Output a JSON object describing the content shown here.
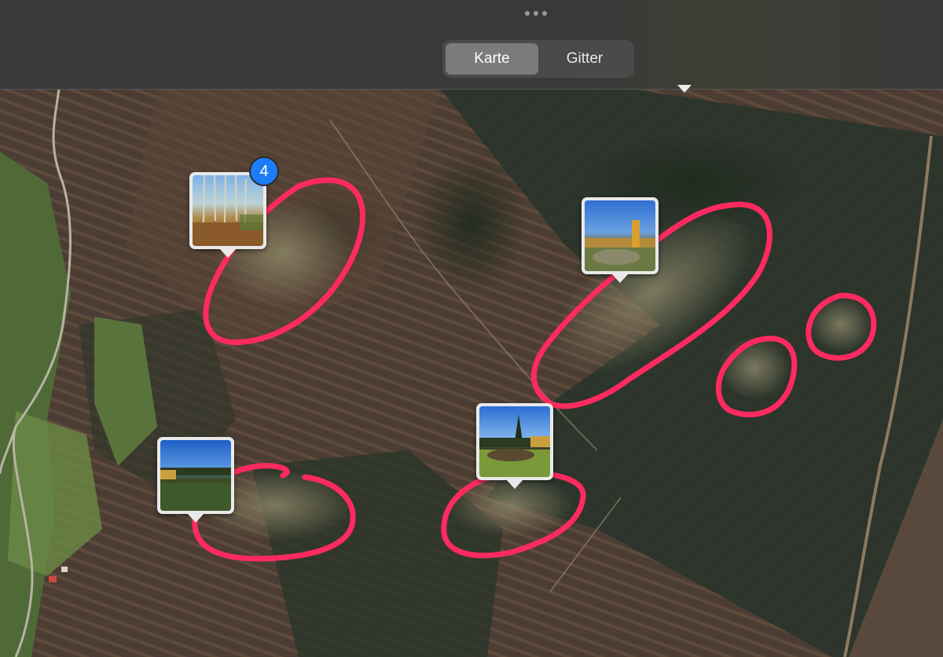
{
  "toolbar": {
    "more_icon": "ellipsis-icon",
    "segments": [
      {
        "label": "Karte",
        "selected": true
      },
      {
        "label": "Gitter",
        "selected": false
      }
    ]
  },
  "map": {
    "type": "satellite",
    "annotation_color": "#ff2a5f",
    "pins": [
      {
        "id": "pin-1",
        "count": "4",
        "scene": "forest-clearing"
      },
      {
        "id": "pin-2",
        "scene": "clearcut-blue-sky"
      },
      {
        "id": "pin-3",
        "scene": "meadow-trees"
      },
      {
        "id": "pin-4",
        "scene": "clearing-with-tall-tree"
      }
    ]
  }
}
